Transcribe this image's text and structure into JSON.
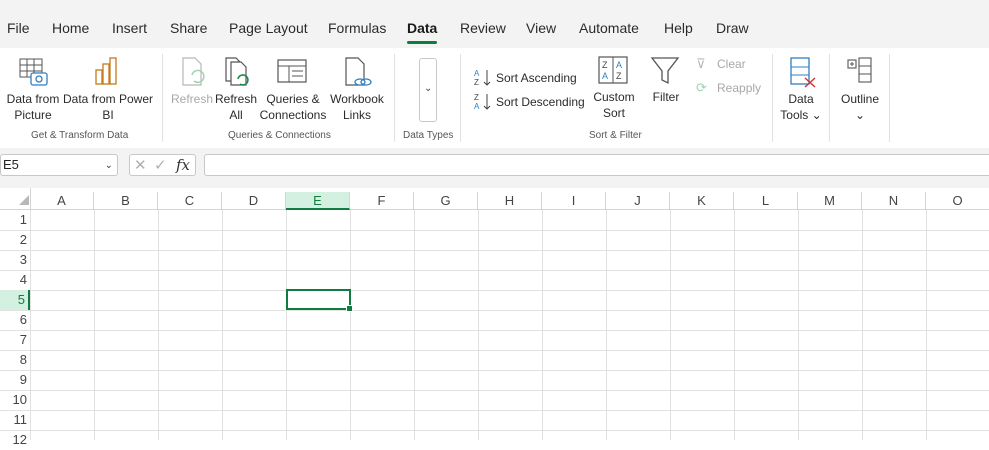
{
  "menu": {
    "tabs": [
      "File",
      "Home",
      "Insert",
      "Share",
      "Page Layout",
      "Formulas",
      "Data",
      "Review",
      "View",
      "Automate",
      "Help",
      "Draw"
    ],
    "active": "Data"
  },
  "ribbon": {
    "get_transform": {
      "data_from_picture": "Data from\nPicture",
      "data_from_power_bi": "Data from Power\nBI",
      "label": "Get & Transform Data"
    },
    "queries": {
      "refresh": "Refresh",
      "refresh_all": "Refresh\nAll",
      "queries_connections": "Queries &\nConnections",
      "workbook_links": "Workbook\nLinks",
      "label": "Queries & Connections"
    },
    "data_types": {
      "label": "Data Types"
    },
    "sort_filter": {
      "sort_ascending": "Sort Ascending",
      "sort_descending": "Sort Descending",
      "custom_sort": "Custom\nSort",
      "filter": "Filter",
      "clear": "Clear",
      "reapply": "Reapply",
      "label": "Sort & Filter"
    },
    "data_tools": "Data\nTools ⌄",
    "outline": "Outline\n⌄"
  },
  "formula_bar": {
    "name_box": "E5",
    "fx": "fx",
    "value": ""
  },
  "grid": {
    "columns": [
      "A",
      "B",
      "C",
      "D",
      "E",
      "F",
      "G",
      "H",
      "I",
      "J",
      "K",
      "L",
      "M",
      "N",
      "O"
    ],
    "rows": [
      "1",
      "2",
      "3",
      "4",
      "5",
      "6",
      "7",
      "8",
      "9",
      "10",
      "11",
      "12"
    ],
    "selected_cell": "E5"
  },
  "colors": {
    "accent": "#107c41",
    "selected_header_bg": "#d3f0e0"
  }
}
